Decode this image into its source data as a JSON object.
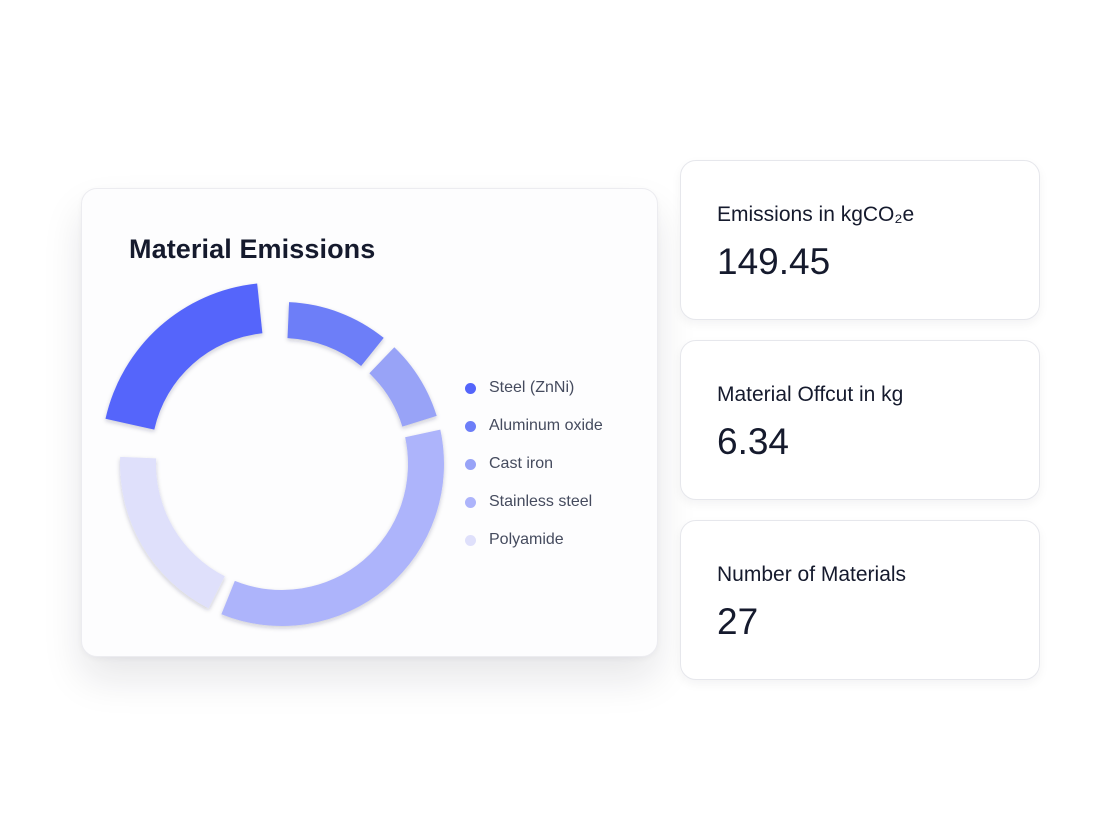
{
  "chart_data": {
    "type": "pie",
    "title": "Material Emissions",
    "categories": [
      "Steel (ZnNi)",
      "Aluminum oxide",
      "Cast iron",
      "Stainless steel",
      "Polyamide"
    ],
    "values": [
      23.6,
      11.5,
      9.4,
      35.9,
      19.6
    ],
    "colors": [
      "#5465fb",
      "#6d7ef8",
      "#98a3f7",
      "#adb4fb",
      "#dfe0fb"
    ],
    "highlighted": "Steel (ZnNi)",
    "legend_position": "right"
  },
  "stats": [
    {
      "label": "Emissions in kgCO₂e",
      "value": "149.45"
    },
    {
      "label": "Material Offcut in kg",
      "value": "6.34"
    },
    {
      "label": "Number of Materials",
      "value": "27"
    }
  ]
}
